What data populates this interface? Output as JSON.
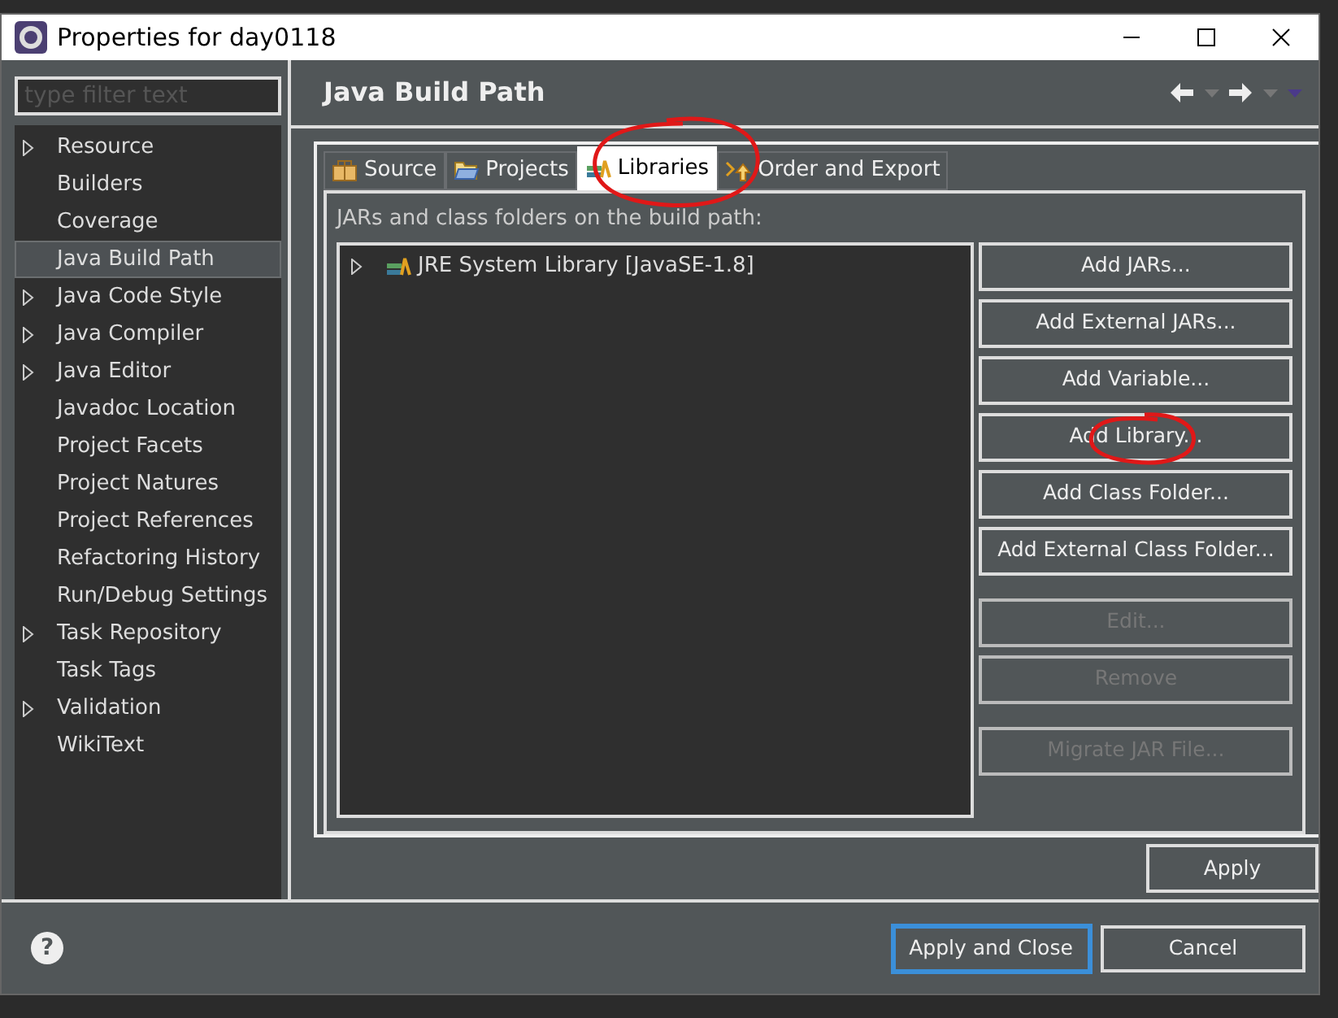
{
  "window": {
    "title": "Properties for day0118"
  },
  "filter": {
    "placeholder": "type filter text"
  },
  "sidebar": {
    "items": [
      {
        "label": "Resource",
        "kind": "collapsed",
        "selected": false
      },
      {
        "label": "Builders",
        "kind": "leaf",
        "selected": false
      },
      {
        "label": "Coverage",
        "kind": "leaf",
        "selected": false
      },
      {
        "label": "Java Build Path",
        "kind": "leaf",
        "selected": true
      },
      {
        "label": "Java Code Style",
        "kind": "collapsed",
        "selected": false
      },
      {
        "label": "Java Compiler",
        "kind": "collapsed",
        "selected": false
      },
      {
        "label": "Java Editor",
        "kind": "collapsed",
        "selected": false
      },
      {
        "label": "Javadoc Location",
        "kind": "leaf",
        "selected": false
      },
      {
        "label": "Project Facets",
        "kind": "leaf",
        "selected": false
      },
      {
        "label": "Project Natures",
        "kind": "leaf",
        "selected": false
      },
      {
        "label": "Project References",
        "kind": "leaf",
        "selected": false
      },
      {
        "label": "Refactoring History",
        "kind": "leaf",
        "selected": false
      },
      {
        "label": "Run/Debug Settings",
        "kind": "leaf",
        "selected": false
      },
      {
        "label": "Task Repository",
        "kind": "collapsed",
        "selected": false
      },
      {
        "label": "Task Tags",
        "kind": "leaf",
        "selected": false
      },
      {
        "label": "Validation",
        "kind": "collapsed",
        "selected": false
      },
      {
        "label": "WikiText",
        "kind": "leaf",
        "selected": false
      }
    ]
  },
  "page": {
    "title": "Java Build Path"
  },
  "tabs": [
    {
      "label": "Source",
      "selected": false
    },
    {
      "label": "Projects",
      "selected": false
    },
    {
      "label": "Libraries",
      "selected": true
    },
    {
      "label": "Order and Export",
      "selected": false
    }
  ],
  "libraries": {
    "caption": "JARs and class folders on the build path:",
    "items": [
      {
        "label": "JRE System Library [JavaSE-1.8]",
        "kind": "collapsed"
      }
    ]
  },
  "side_buttons": [
    {
      "label": "Add JARs...",
      "disabled": false
    },
    {
      "label": "Add External JARs...",
      "disabled": false
    },
    {
      "label": "Add Variable...",
      "disabled": false
    },
    {
      "label": "Add Library...",
      "disabled": false
    },
    {
      "label": "Add Class Folder...",
      "disabled": false
    },
    {
      "label": "Add External Class Folder...",
      "disabled": false
    },
    {
      "label": "Edit...",
      "disabled": true
    },
    {
      "label": "Remove",
      "disabled": true
    },
    {
      "label": "Migrate JAR File...",
      "disabled": true
    }
  ],
  "apply_button": "Apply",
  "help_button": "?",
  "footer_buttons": [
    {
      "label": "Apply and Close",
      "selected": true
    },
    {
      "label": "Cancel",
      "selected": false
    }
  ]
}
